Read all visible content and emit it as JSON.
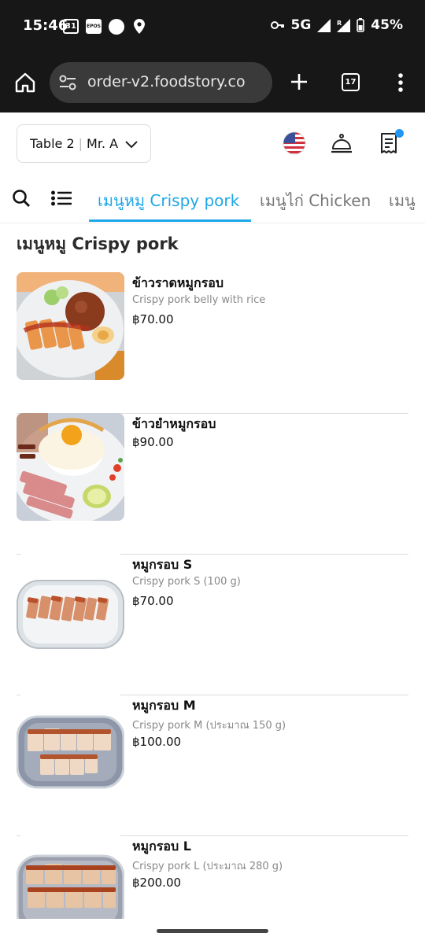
{
  "status_bar": {
    "time": "15:46",
    "calendar_day": "31",
    "epos_label": "EPOS",
    "network": "5G",
    "battery": "45%"
  },
  "browser": {
    "url": "order-v2.foodstory.co",
    "tab_count": "17"
  },
  "header": {
    "table": "Table 2",
    "customer": "Mr. A"
  },
  "categories": [
    {
      "label": "เมนูหมู Crispy pork",
      "active": true
    },
    {
      "label": "เมนูไก่ Chicken",
      "active": false
    },
    {
      "label": "เมนู",
      "active": false
    }
  ],
  "section_title": "เมนูหมู Crispy pork",
  "items": [
    {
      "name": "ข้าวราดหมูกรอบ",
      "description": "Crispy pork belly with rice",
      "price": "฿70.00"
    },
    {
      "name": "ข้าวยำหมูกรอบ",
      "description": "",
      "price": "฿90.00"
    },
    {
      "name": "หมูกรอบ S",
      "description": "Crispy pork S (100 g)",
      "price": "฿70.00"
    },
    {
      "name": "หมูกรอบ M",
      "description": "Crispy pork M (ประมาณ 150 g)",
      "price": "฿100.00"
    },
    {
      "name": "หมูกรอบ L",
      "description": "Crispy pork L (ประมาณ 280 g)",
      "price": "฿200.00"
    }
  ],
  "colors": {
    "accent": "#1ea7e8",
    "cart_badge": "#2196f3",
    "chrome_bg": "#171717"
  }
}
